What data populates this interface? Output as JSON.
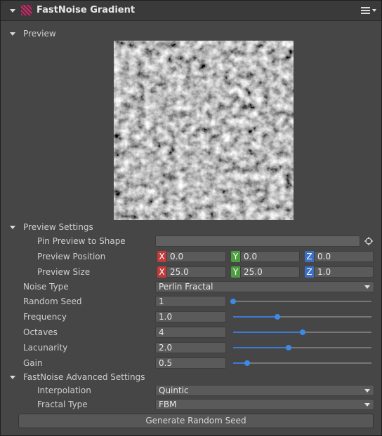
{
  "header": {
    "title": "FastNoise Gradient",
    "icon": "fastnoise-component-icon",
    "menu_icon": "hamburger-menu-icon"
  },
  "preview": {
    "section_label": "Preview"
  },
  "preview_settings": {
    "section_label": "Preview Settings",
    "pin_label": "Pin Preview to Shape",
    "pin_value": "",
    "position_label": "Preview Position",
    "position": {
      "x": "0.0",
      "y": "0.0",
      "z": "0.0"
    },
    "size_label": "Preview Size",
    "size": {
      "x": "25.0",
      "y": "25.0",
      "z": "1.0"
    },
    "axis_labels": {
      "x": "X",
      "y": "Y",
      "z": "Z"
    }
  },
  "noise_type": {
    "label": "Noise Type",
    "value": "Perlin Fractal"
  },
  "random_seed": {
    "label": "Random Seed",
    "value": "1",
    "slider_fraction": 0.0
  },
  "frequency": {
    "label": "Frequency",
    "value": "1.0",
    "slider_fraction": 0.32
  },
  "octaves": {
    "label": "Octaves",
    "value": "4",
    "slider_fraction": 0.5
  },
  "lacunarity": {
    "label": "Lacunarity",
    "value": "2.0",
    "slider_fraction": 0.4
  },
  "gain": {
    "label": "Gain",
    "value": "0.5",
    "slider_fraction": 0.1
  },
  "advanced": {
    "section_label": "FastNoise Advanced Settings",
    "interpolation_label": "Interpolation",
    "interpolation_value": "Quintic",
    "fractal_type_label": "Fractal Type",
    "fractal_type_value": "FBM"
  },
  "generate_button": "Generate Random Seed",
  "colors": {
    "panel": "#464646",
    "header": "#3a3a3a",
    "field": "#5a5a5a",
    "accent": "#3d8ae6",
    "x_axis": "#c03b3b",
    "y_axis": "#4c9e3e",
    "z_axis": "#3d6fc4"
  }
}
